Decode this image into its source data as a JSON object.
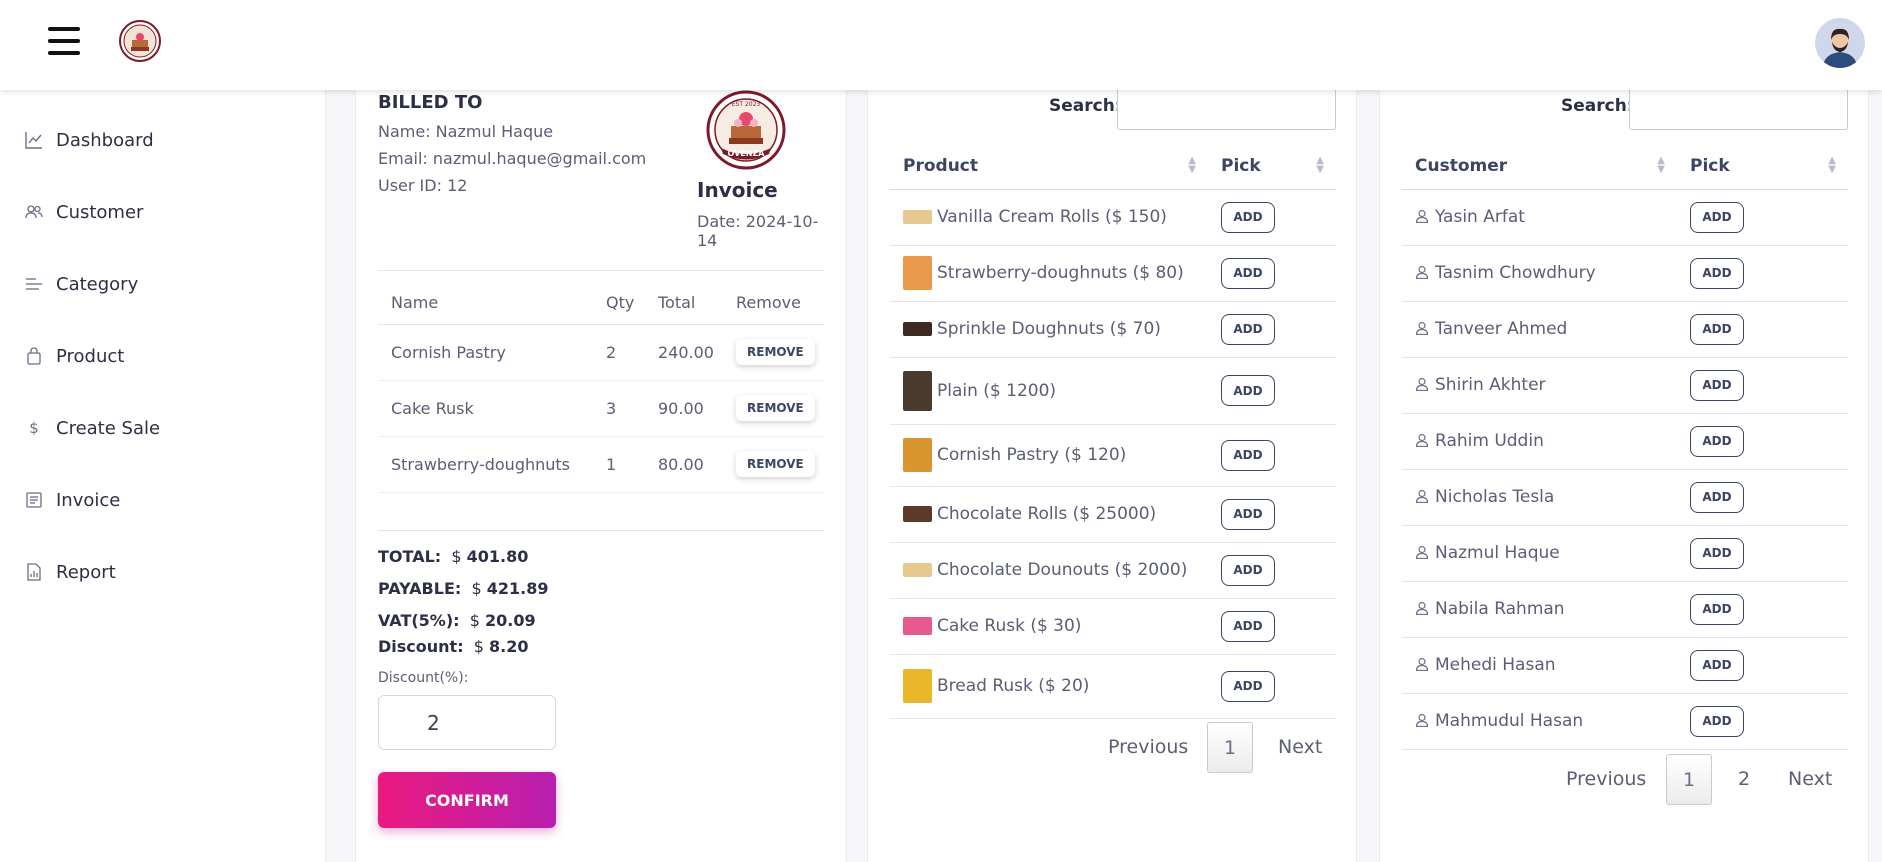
{
  "topbar": {
    "menu_icon": "hamburger-menu-icon",
    "logo": "bakery-logo",
    "avatar": "user-avatar"
  },
  "sidebar": {
    "items": [
      {
        "label": "Dashboard",
        "icon": "chart-line-icon"
      },
      {
        "label": "Customer",
        "icon": "users-icon"
      },
      {
        "label": "Category",
        "icon": "list-icon"
      },
      {
        "label": "Product",
        "icon": "bag-icon"
      },
      {
        "label": "Create Sale",
        "icon": "dollar-icon"
      },
      {
        "label": "Invoice",
        "icon": "document-icon"
      },
      {
        "label": "Report",
        "icon": "report-icon"
      }
    ]
  },
  "invoice": {
    "billed_to": "BILLED TO",
    "name": "Name: Nazmul Haque",
    "email": "Email: nazmul.haque@gmail.com",
    "user_id": "User ID: 12",
    "logo_text": "OVENZA",
    "logo_est": "EST 2023",
    "title": "Invoice",
    "date": "Date: 2024-10-14",
    "headers": {
      "name": "Name",
      "qty": "Qty",
      "total": "Total",
      "remove": "Remove"
    },
    "items": [
      {
        "name": "Cornish Pastry",
        "qty": "2",
        "total": "240.00"
      },
      {
        "name": "Cake Rusk",
        "qty": "3",
        "total": "90.00"
      },
      {
        "name": "Strawberry-doughnuts",
        "qty": "1",
        "total": "80.00"
      }
    ],
    "remove_label": "REMOVE",
    "total_label": "TOTAL:",
    "total_value": "401.80",
    "payable_label": "PAYABLE:",
    "payable_value": "421.89",
    "vat_label": "VAT(5%):",
    "vat_value": "20.09",
    "discount_label": "Discount:",
    "discount_value": "8.20",
    "currency": "$",
    "discount_pct_label": "Discount(%):",
    "discount_pct_value": "2",
    "confirm_label": "CONFIRM"
  },
  "products": {
    "search_label": "Search:",
    "search_value": "",
    "col_product": "Product",
    "col_pick": "Pick",
    "add_label": "ADD",
    "rows": [
      {
        "label": "Vanilla Cream Rolls ($ 150)",
        "thumb": "#e7c98f"
      },
      {
        "label": "Strawberry-doughnuts ($ 80)",
        "thumb": "#e89a4a"
      },
      {
        "label": "Sprinkle Doughnuts ($ 70)",
        "thumb": "#3a2a22"
      },
      {
        "label": "Plain ($ 1200)",
        "thumb": "#4a3b2f"
      },
      {
        "label": "Cornish Pastry ($ 120)",
        "thumb": "#d9962f"
      },
      {
        "label": "Chocolate Rolls ($ 25000)",
        "thumb": "#5b3a27"
      },
      {
        "label": "Chocolate Dounouts ($ 2000)",
        "thumb": "#e7c98f"
      },
      {
        "label": "Cake Rusk ($ 30)",
        "thumb": "#e65a8f"
      },
      {
        "label": "Bread Rusk ($ 20)",
        "thumb": "#e9b72a"
      }
    ],
    "prev_label": "Previous",
    "next_label": "Next",
    "pages": [
      "1"
    ]
  },
  "customers": {
    "search_label": "Search:",
    "search_value": "",
    "col_customer": "Customer",
    "col_pick": "Pick",
    "add_label": "ADD",
    "rows": [
      "Yasin Arfat",
      "Tasnim Chowdhury",
      "Tanveer Ahmed",
      "Shirin Akhter",
      "Rahim Uddin",
      "Nicholas Tesla",
      "Nazmul Haque",
      "Nabila Rahman",
      "Mehedi Hasan",
      "Mahmudul Hasan"
    ],
    "prev_label": "Previous",
    "next_label": "Next",
    "pages": [
      "1",
      "2"
    ]
  }
}
